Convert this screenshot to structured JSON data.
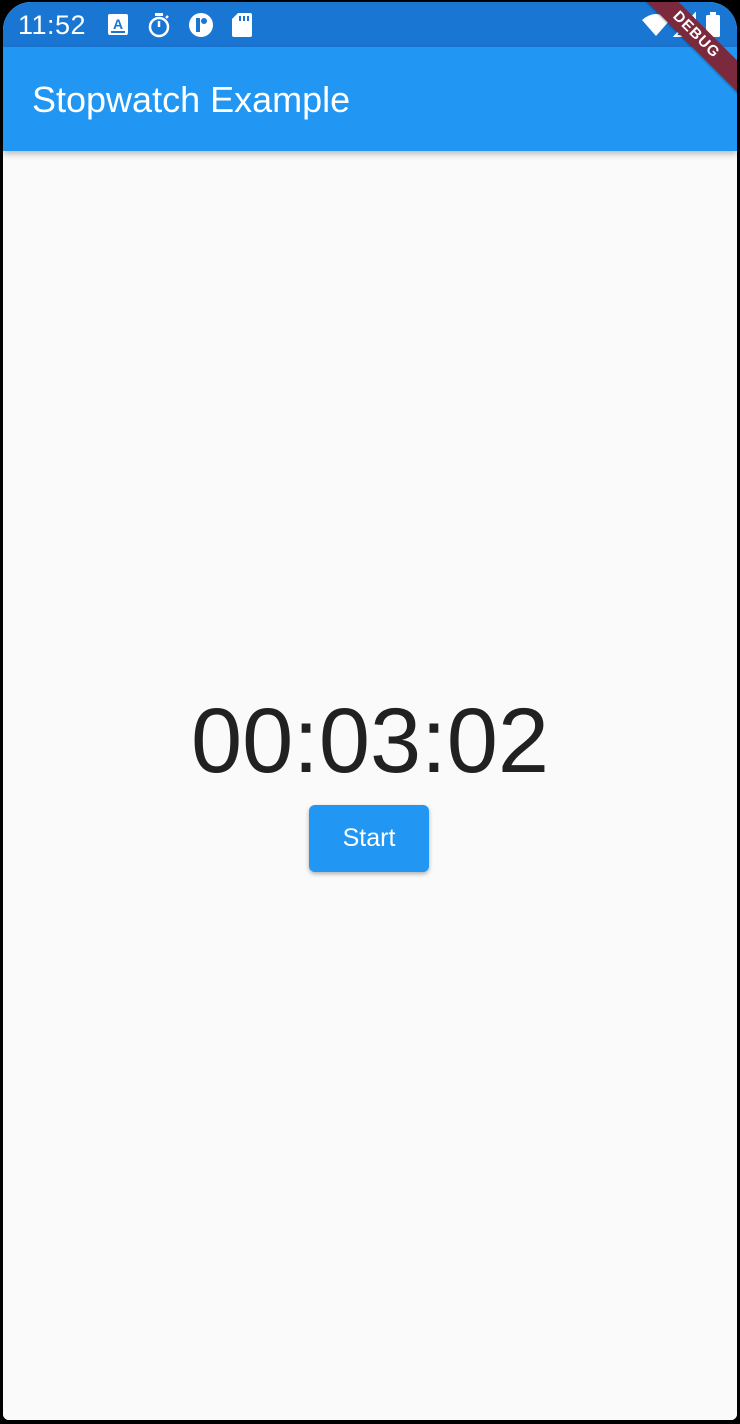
{
  "status_bar": {
    "time": "11:52",
    "left_icons": [
      "a-box-icon",
      "timer-icon",
      "mastodon-icon",
      "sd-card-icon"
    ],
    "right_icons": [
      "wifi-icon",
      "cell-signal-icon",
      "battery-icon"
    ]
  },
  "app_bar": {
    "title": "Stopwatch Example"
  },
  "stopwatch": {
    "elapsed": "00:03:02",
    "start_label": "Start"
  },
  "debug_banner": {
    "label": "DEBUG"
  },
  "colors": {
    "status_bar": "#1976d2",
    "app_bar": "#2196f3",
    "button": "#2196f3",
    "background": "#fafafa",
    "text": "#212121",
    "debug_banner": "#7b2a3e"
  }
}
